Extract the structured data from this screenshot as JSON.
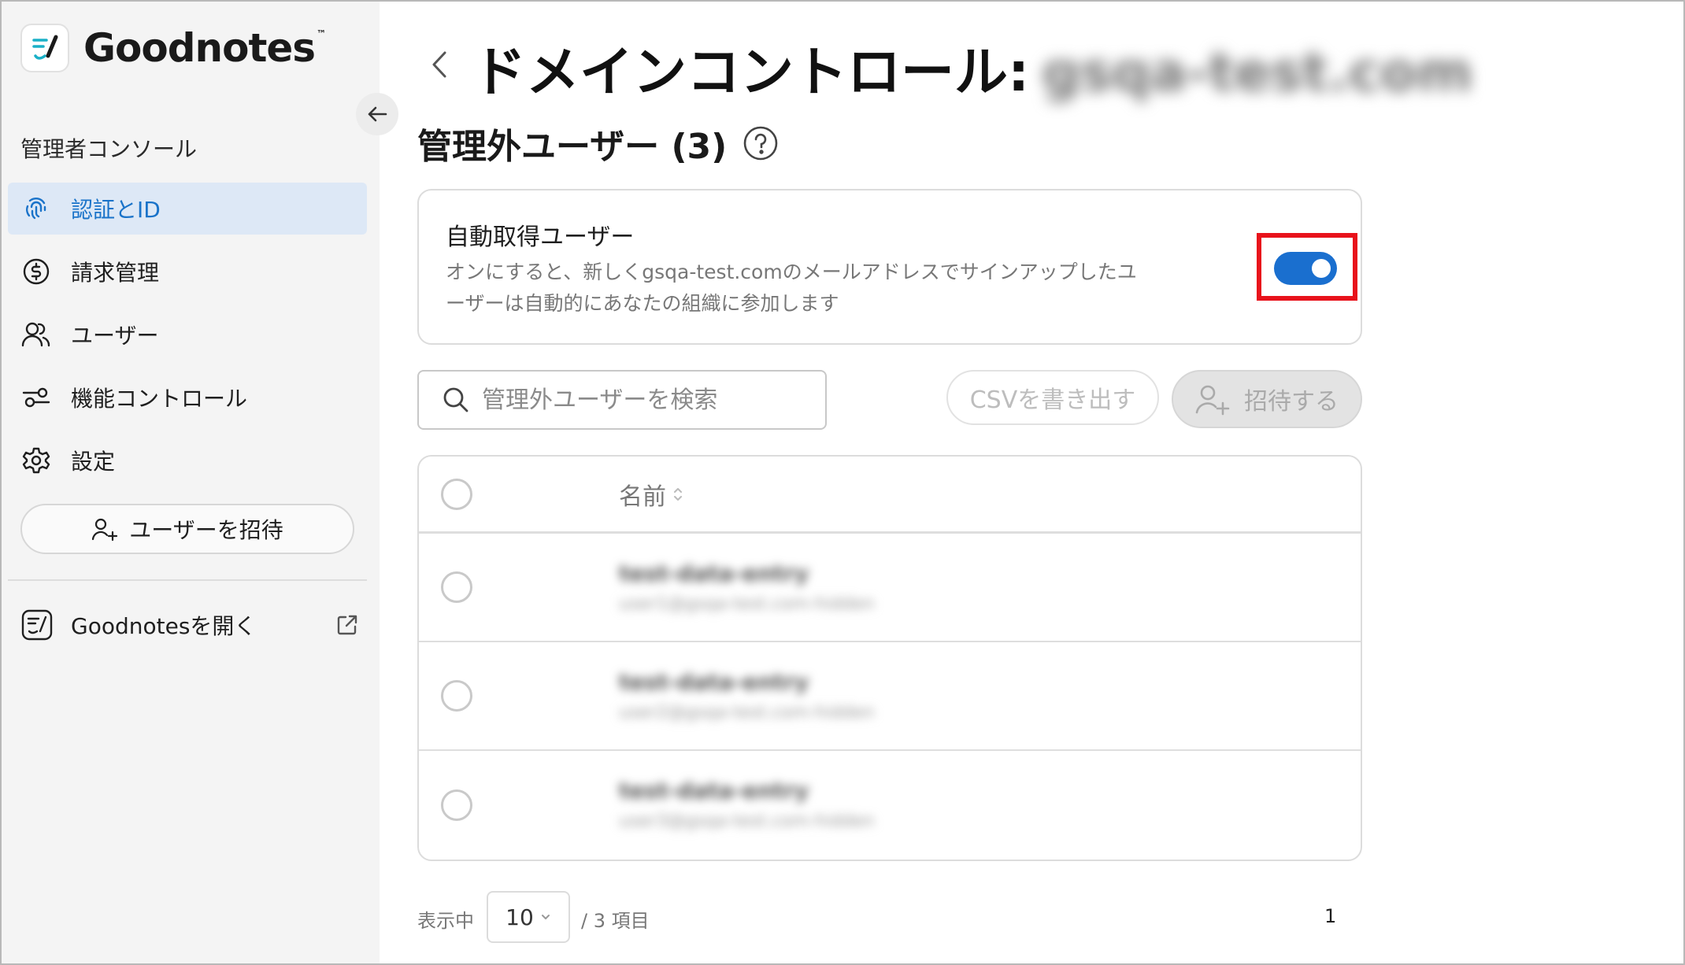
{
  "app": {
    "logo_text": "Goodnotes",
    "logo_tm": "™"
  },
  "sidebar": {
    "section_title": "管理者コンソール",
    "items": [
      {
        "label": "認証とID",
        "icon": "fingerprint-icon",
        "active": true
      },
      {
        "label": "請求管理",
        "icon": "dollar-circle-icon",
        "active": false
      },
      {
        "label": "ユーザー",
        "icon": "users-icon",
        "active": false
      },
      {
        "label": "機能コントロール",
        "icon": "sliders-icon",
        "active": false
      },
      {
        "label": "設定",
        "icon": "gear-icon",
        "active": false
      }
    ],
    "invite_label": "ユーザーを招待",
    "open_goodnotes_label": "Goodnotesを開く"
  },
  "header": {
    "title": "ドメインコントロール:",
    "domain_blurred": "gsqa-test.com"
  },
  "section": {
    "title": "管理外ユーザー (3)"
  },
  "auto_capture": {
    "title": "自動取得ユーザー",
    "description_line1": "オンにすると、新しくgsqa-test.comのメールアドレスでサインアップしたユ",
    "description_line2": "ーザーは自動的にあなたの組織に参加します",
    "toggle_on": true,
    "toggle_color": "#1a6fcf",
    "highlight_color": "#e8121b"
  },
  "toolbar": {
    "search_placeholder": "管理外ユーザーを検索",
    "export_csv_label": "CSVを書き出す",
    "invite_label": "招待する"
  },
  "table": {
    "name_header": "名前",
    "rows": [
      {
        "name": "test-data-entry",
        "email": "user1@gsqa-test.com-hidden"
      },
      {
        "name": "test-data-entry",
        "email": "user2@gsqa-test.com-hidden"
      },
      {
        "name": "test-data-entry",
        "email": "user3@gsqa-test.com-hidden"
      }
    ]
  },
  "pagination": {
    "showing_label": "表示中",
    "page_size": "10",
    "total_label": "/ 3 項目",
    "current_page": "1"
  },
  "colors": {
    "accent": "#1a6fcf",
    "sidebar_bg": "#f4f4f4",
    "active_bg": "#dde8f6"
  }
}
